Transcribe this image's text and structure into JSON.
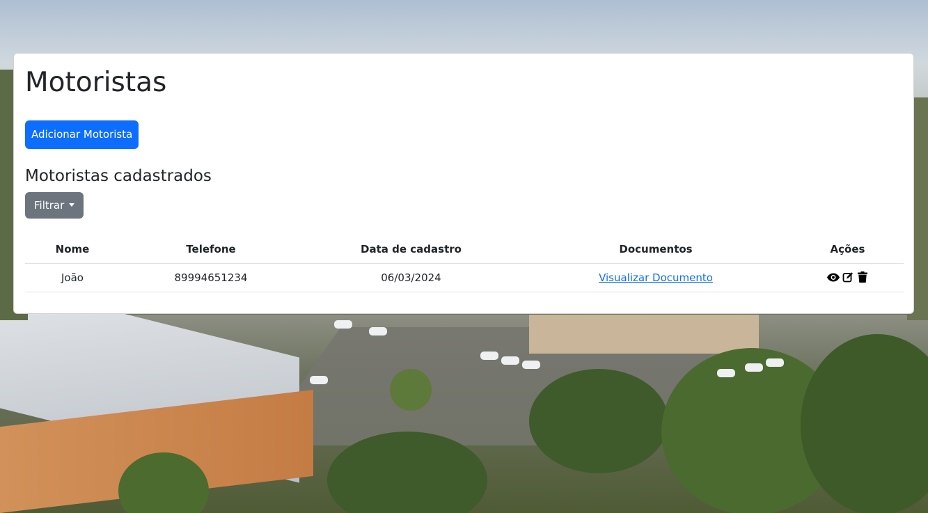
{
  "page": {
    "title": "Motoristas",
    "add_button": "Adicionar Motorista",
    "subtitle": "Motoristas cadastrados",
    "filter_button": "Filtrar"
  },
  "table": {
    "headers": [
      "Nome",
      "Telefone",
      "Data de cadastro",
      "Documentos",
      "Ações"
    ],
    "rows": [
      {
        "nome": "João",
        "telefone": "89994651234",
        "data": "06/03/2024",
        "documento": "Visualizar Documento",
        "actions": [
          "eye-icon",
          "edit-icon",
          "trash-icon"
        ]
      }
    ]
  },
  "colors": {
    "primary": "#0d6efd",
    "secondary": "#6c757d",
    "text": "#212529"
  }
}
